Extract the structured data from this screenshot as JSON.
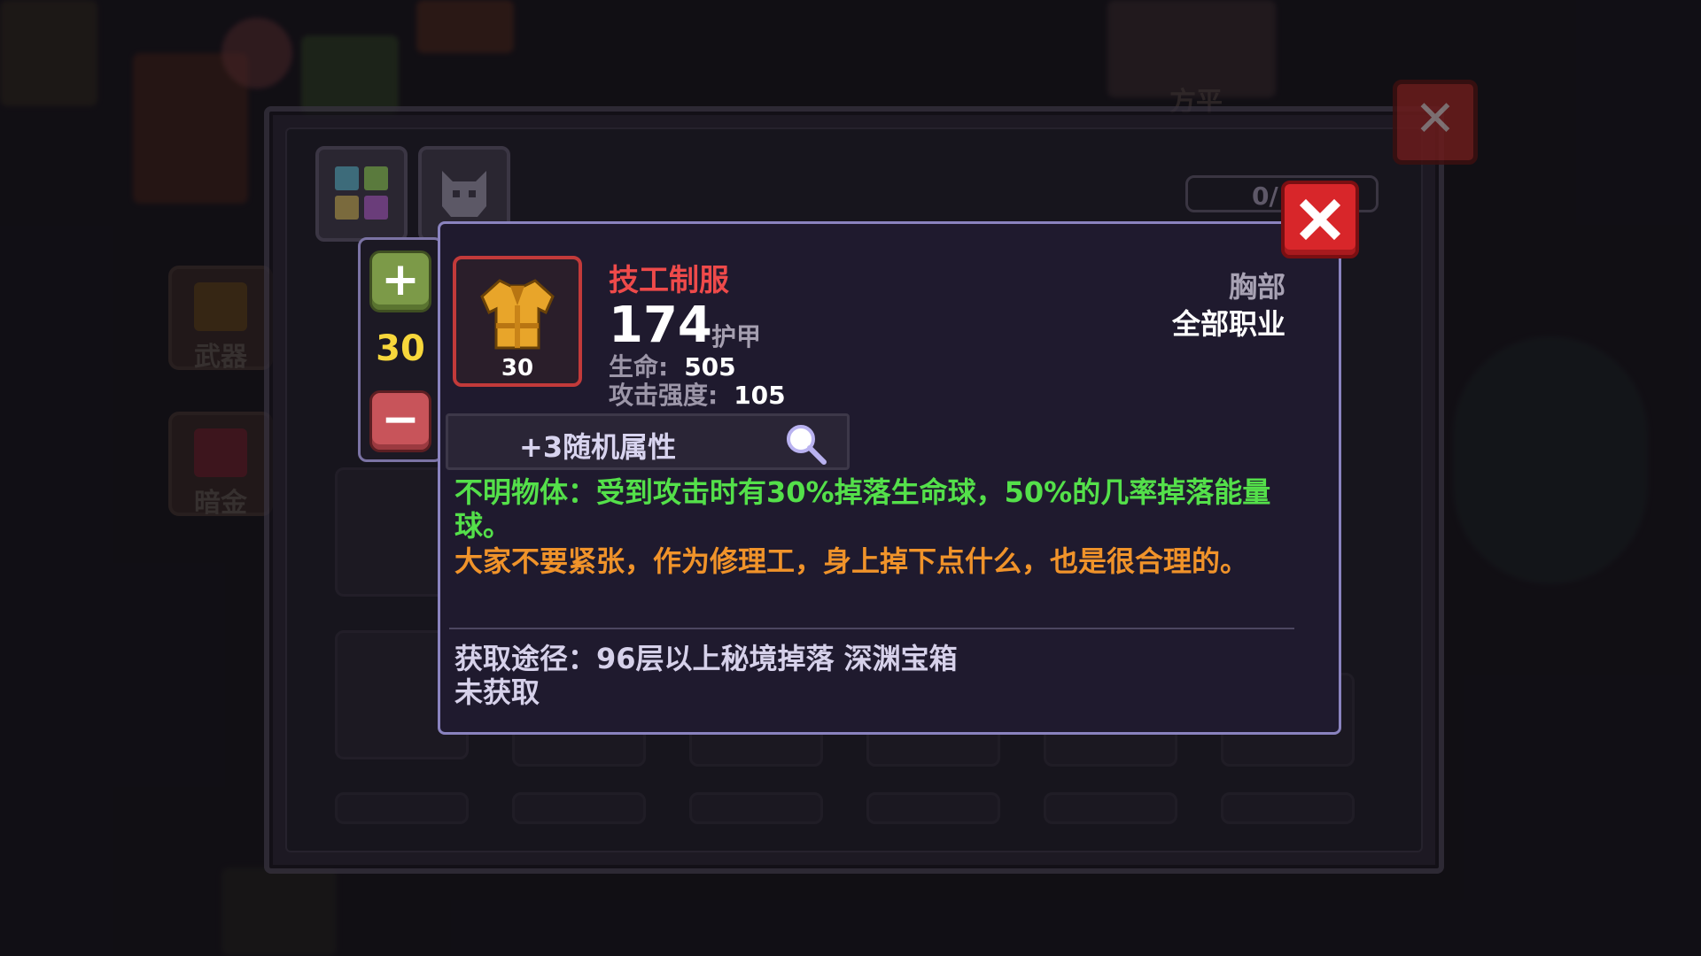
{
  "background": {
    "categories": [
      {
        "label": "武器",
        "icon": "weapon-category-icon"
      },
      {
        "label": "暗金",
        "icon": "dark-gold-category-icon"
      }
    ],
    "partial_label": "方平"
  },
  "inventory": {
    "counter": "0/",
    "tabs": [
      "all-items-tab-icon",
      "pet-tab-icon"
    ]
  },
  "stepper": {
    "value": "30",
    "plus_icon": "plus-icon",
    "minus_icon": "minus-icon"
  },
  "item": {
    "name": "技工制服",
    "level": "30",
    "icon": "uniform-armor-icon",
    "armor_value": "174",
    "armor_label": "护甲",
    "stats": [
      {
        "label": "生命:",
        "value": "505"
      },
      {
        "label": "攻击强度:",
        "value": "105"
      }
    ],
    "slot": "胸部",
    "class_requirement": "全部职业",
    "random_attributes": "+3随机属性",
    "effect": "不明物体：受到攻击时有30%掉落生命球，50%的几率掉落能量球。",
    "flavor": "大家不要紧张，作为修理工，身上掉下点什么，也是很合理的。",
    "source": "获取途径：96层以上秘境掉落 深渊宝箱",
    "status": "未获取"
  },
  "colors": {
    "item_name": "#ee4a4a",
    "effect": "#54e04a",
    "flavor": "#f0932a",
    "panel_border": "#8a83bf",
    "stepper_value": "#f7d73b",
    "close": "#d8262a"
  }
}
